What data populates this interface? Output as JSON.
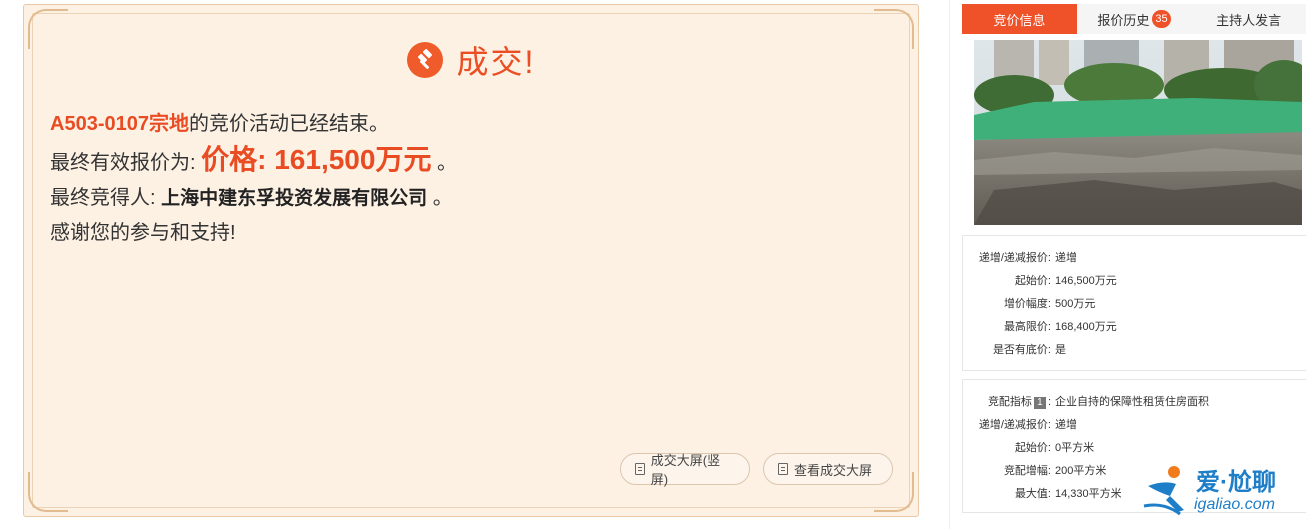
{
  "result": {
    "title": "成交!",
    "lot_id": "A503-0107宗地",
    "line1_suffix": "的竞价活动已经结束。",
    "line2_prefix": "最终有效报价为:",
    "price_text": "价格: 161,500万元",
    "line2_suffix": "。",
    "line3_prefix": "最终竞得人: ",
    "winner": "上海中建东孚投资发展有限公司",
    "line3_suffix": " 。",
    "line4": "感谢您的参与和支持!",
    "btn_portrait": "成交大屏(竖屏)",
    "btn_view": "查看成交大屏"
  },
  "tabs": [
    {
      "label": "竞价信息",
      "active": true
    },
    {
      "label": "报价历史",
      "badge": "35"
    },
    {
      "label": "主持人发言"
    }
  ],
  "info1": [
    {
      "key": "递增/递减报价:",
      "value": "递增"
    },
    {
      "key": "起始价:",
      "value": "146,500万元"
    },
    {
      "key": "增价幅度:",
      "value": "500万元"
    },
    {
      "key": "最高限价:",
      "value": "168,400万元"
    },
    {
      "key": "是否有底价:",
      "value": "是"
    }
  ],
  "info2": {
    "index_key": "竞配指标",
    "index_badge": "1",
    "index_colon": ":",
    "index_value": "企业自持的保障性租赁住房面积",
    "rows": [
      {
        "key": "递增/递减报价:",
        "value": "递增"
      },
      {
        "key": "起始价:",
        "value": "0平方米"
      },
      {
        "key": "竞配增幅:",
        "value": "200平方米"
      },
      {
        "key": "最大值:",
        "value": "14,330平方米"
      }
    ]
  },
  "watermark": {
    "brand": "爱·尬聊",
    "url": "igaliao.com"
  },
  "colors": {
    "accent": "#ef5128",
    "card_bg": "#fdf1e4",
    "brand_blue": "#1f7ec8"
  }
}
